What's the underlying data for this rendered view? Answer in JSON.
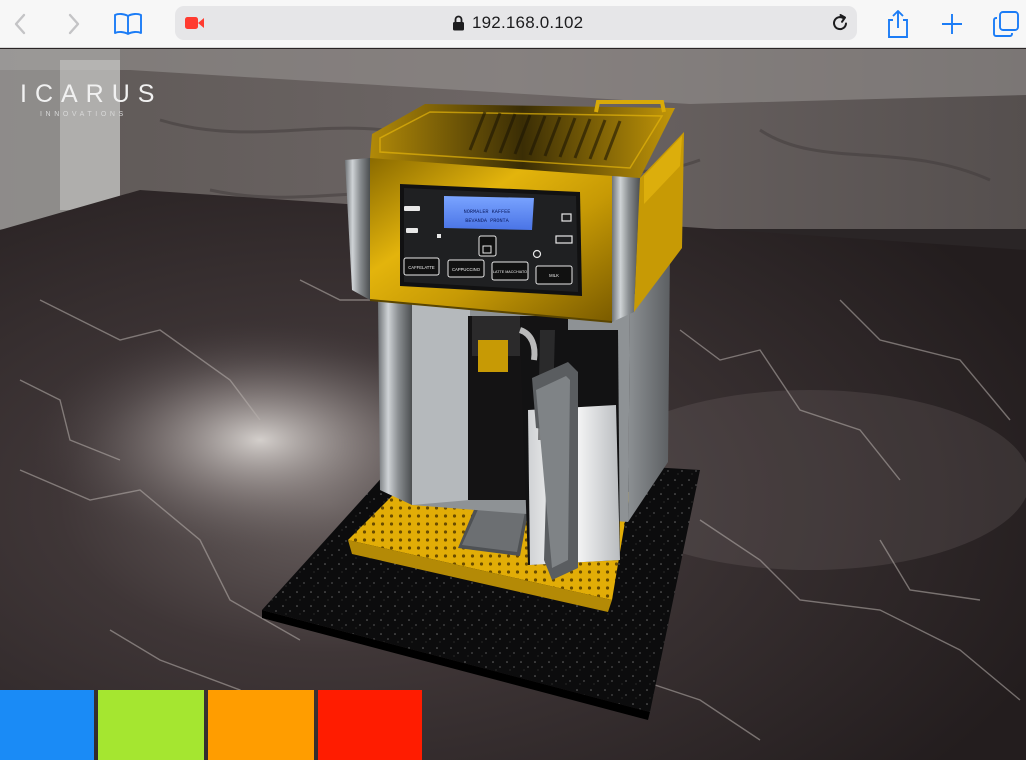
{
  "browser": {
    "url": "192.168.0.102",
    "icons": [
      "back-icon",
      "forward-icon",
      "bookmarks-icon",
      "screen-record-icon",
      "lock-icon",
      "reload-icon",
      "share-icon",
      "new-tab-icon",
      "tabs-icon"
    ]
  },
  "logo": {
    "name": "ICARUS",
    "tagline": "INNOVATIONS"
  },
  "machine": {
    "display_line1": "NORMALER KAFFEE",
    "display_line2": "BEVANDA PRONTA",
    "buttons": [
      "CAFFELATTE",
      "CAPPUCCINO",
      "LATTE MACCHIATO",
      "MILK"
    ]
  },
  "color_swatches": [
    {
      "name": "blue",
      "color": "#1a8bf6"
    },
    {
      "name": "green",
      "color": "#a5e630"
    },
    {
      "name": "orange",
      "color": "#ff9d00"
    },
    {
      "name": "red",
      "color": "#ff1c00"
    }
  ]
}
